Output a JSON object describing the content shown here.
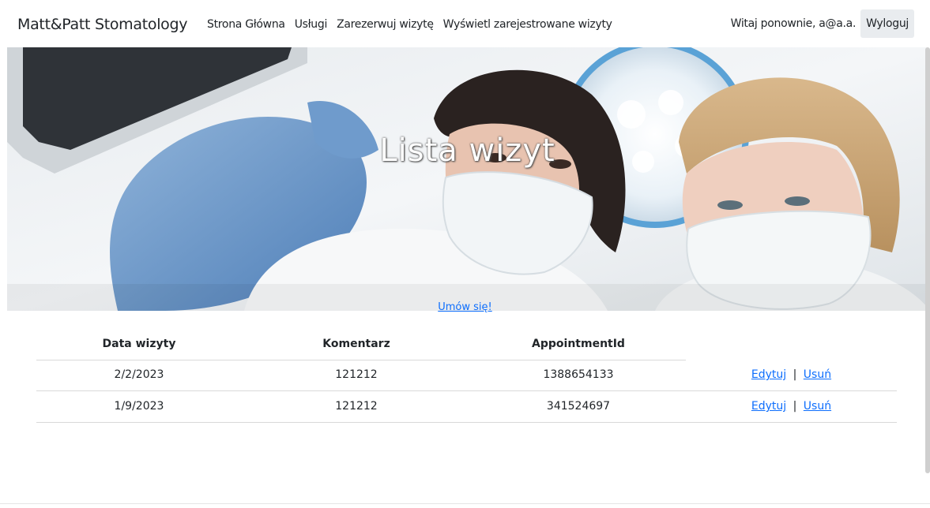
{
  "navbar": {
    "brand": "Matt&Patt Stomatology",
    "links": [
      "Strona Główna",
      "Usługi",
      "Zarezerwuj wizytę",
      "Wyświetl zarejestrowane wizyty"
    ],
    "greeting": "Witaj ponownie, a@a.a.",
    "logout": "Wyloguj"
  },
  "hero": {
    "title": "Lista wizyt"
  },
  "book_link": "Umów się!",
  "table": {
    "headers": [
      "Data wizyty",
      "Komentarz",
      "AppointmentId"
    ],
    "rows": [
      {
        "date": "2/2/2023",
        "comment": "121212",
        "id": "1388654133"
      },
      {
        "date": "1/9/2023",
        "comment": "121212",
        "id": "341524697"
      }
    ],
    "edit_label": "Edytuj",
    "separator": "|",
    "delete_label": "Usuń"
  },
  "colors": {
    "link": "#0d6efd",
    "text": "#212529",
    "logout_bg": "#e9ecef"
  }
}
